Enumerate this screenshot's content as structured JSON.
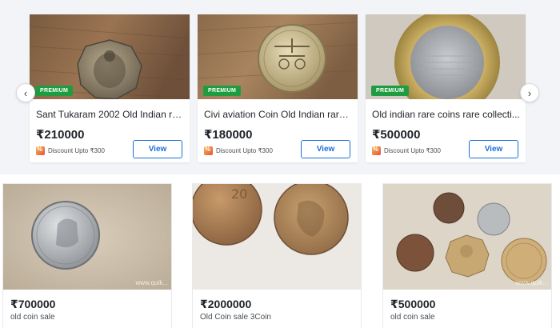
{
  "featured": {
    "prev_icon": "chevron-left-icon",
    "next_icon": "chevron-right-icon",
    "prev_glyph": "‹",
    "next_glyph": "›",
    "cards": [
      {
        "badge": "PREMIUM",
        "title": "Sant Tukaram 2002 Old Indian rar...",
        "price": "₹210000",
        "discount": "Discount Upto ₹300",
        "button": "View"
      },
      {
        "badge": "PREMIUM",
        "title": "Civi aviation Coin Old Indian rare ...",
        "price": "₹180000",
        "discount": "Discount Upto ₹300",
        "button": "View"
      },
      {
        "badge": "PREMIUM",
        "title": "Old indian rare coins rare collecti...",
        "price": "₹500000",
        "discount": "Discount Upto ₹300",
        "button": "View"
      }
    ]
  },
  "listings": [
    {
      "price": "₹700000",
      "title": "old coin sale",
      "watermark": "www.quik..."
    },
    {
      "price": "₹2000000",
      "title": "Old Coin sale 3Coin",
      "watermark": ""
    },
    {
      "price": "₹500000",
      "title": "old coin sale",
      "watermark": "www.quik..."
    }
  ],
  "colors": {
    "premium_badge": "#1e9c3f",
    "view_button": "#1d6fd8",
    "carousel_bg": "#f2f4f7"
  }
}
